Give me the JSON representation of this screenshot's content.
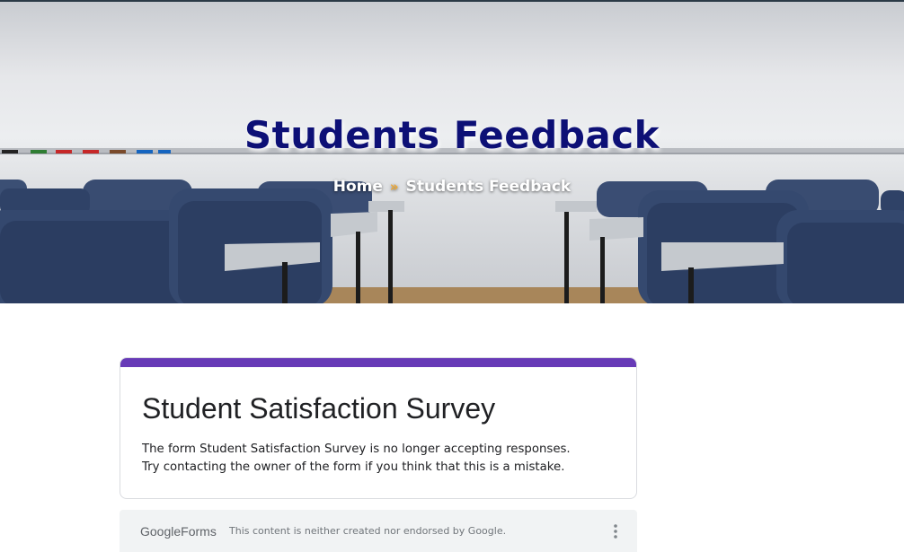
{
  "hero": {
    "title": "Students Feedback",
    "breadcrumb": {
      "home": "Home",
      "separator": "»",
      "current": "Students Feedback"
    }
  },
  "form": {
    "title": "Student Satisfaction Survey",
    "message_line1": "The form Student Satisfaction Survey is no longer accepting responses.",
    "message_line2": "Try contacting the owner of the form if you think that this is a mistake.",
    "accent_color": "#673ab7"
  },
  "footer": {
    "logo_google": "Google",
    "logo_forms": "Forms",
    "disclaimer": "This content is neither created nor endorsed by Google."
  },
  "colors": {
    "title": "#0d1076",
    "breadcrumb_separator": "#f0a830"
  }
}
